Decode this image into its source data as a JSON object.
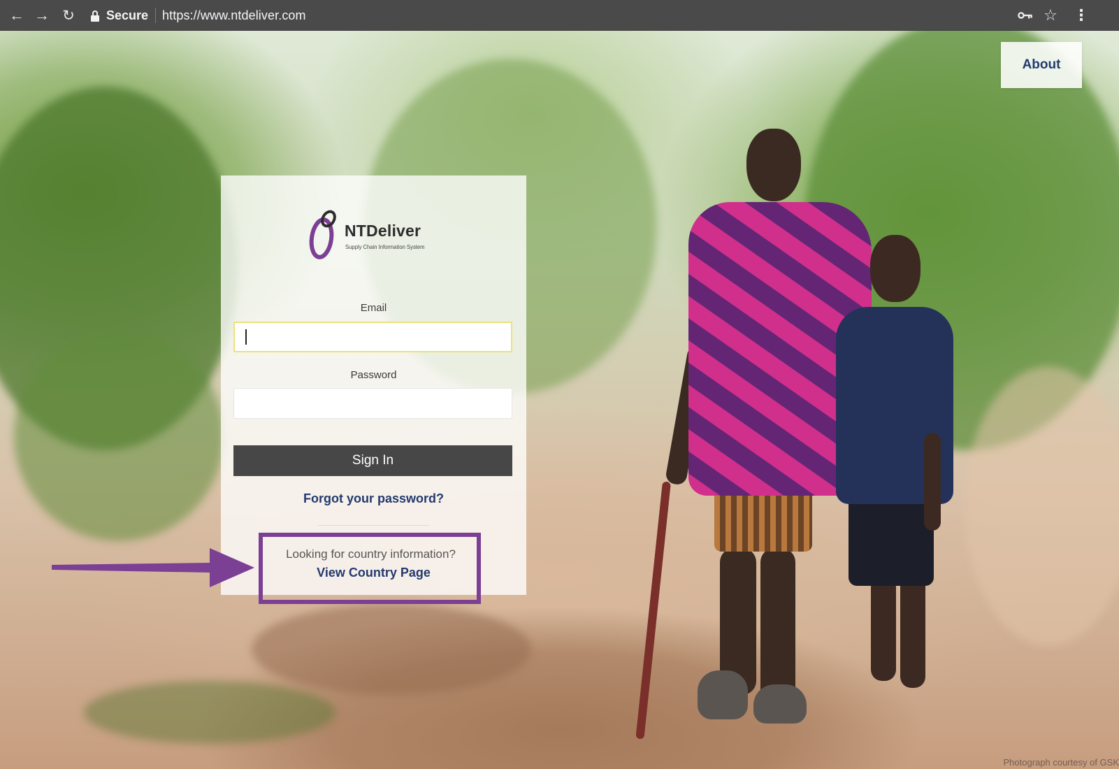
{
  "browser": {
    "security_label": "Secure",
    "url": "https://www.ntdeliver.com",
    "icons": {
      "back": "back-arrow-icon",
      "forward": "forward-arrow-icon",
      "reload": "reload-icon",
      "lock": "lock-icon",
      "key": "key-icon",
      "star": "star-icon",
      "menu": "kebab-menu-icon"
    }
  },
  "header": {
    "about_label": "About"
  },
  "login": {
    "logo_name": "NTDeliver",
    "logo_tagline": "Supply Chain Information System",
    "email_label": "Email",
    "email_value": "",
    "password_label": "Password",
    "password_value": "",
    "signin_label": "Sign In",
    "forgot_label": "Forgot your password?",
    "country_prompt": "Looking for country information?",
    "country_link_label": "View Country Page"
  },
  "footer": {
    "photo_credit": "Photograph courtesy of GSK"
  },
  "colors": {
    "brand_purple": "#7b3f94",
    "link_navy": "#233a6e",
    "signin_button": "#474747",
    "browser_bar": "#4a4a4a"
  }
}
